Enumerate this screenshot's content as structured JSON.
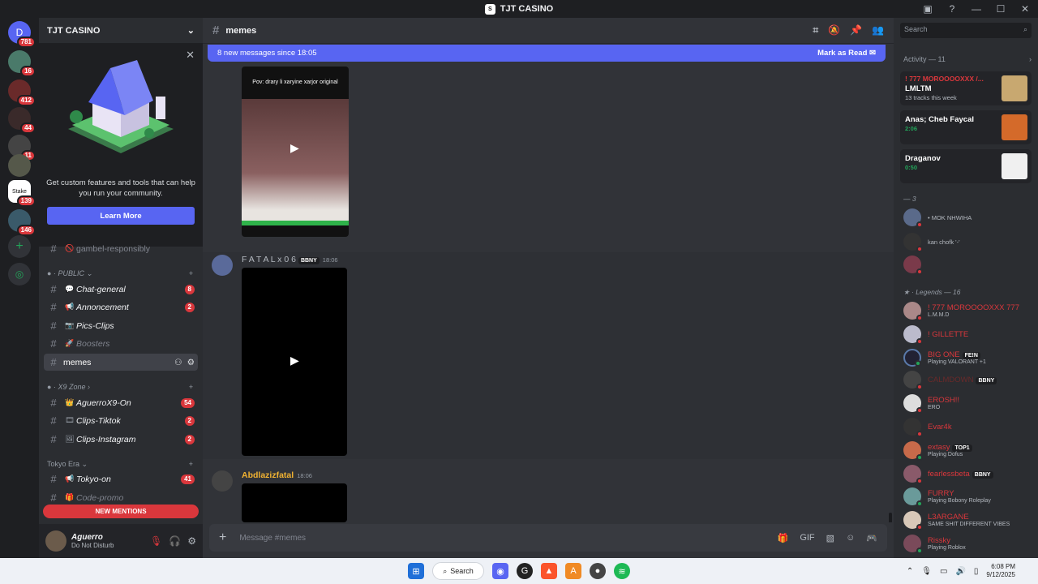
{
  "window": {
    "title": "TJT CASINO"
  },
  "server": {
    "name": "TJT CASINO"
  },
  "guilds": [
    {
      "label": "D",
      "badge": "781"
    },
    {
      "label": "",
      "badge": "16"
    },
    {
      "label": "",
      "badge": "412"
    },
    {
      "label": "",
      "badge": "44"
    },
    {
      "label": "",
      "badge": "11"
    },
    {
      "label": "",
      "badge": ""
    },
    {
      "label": "Stake",
      "badge": "139"
    },
    {
      "label": "",
      "badge": "146"
    }
  ],
  "promo": {
    "text": "Get custom features and tools that can help you run your community.",
    "button": "Learn More"
  },
  "channels": {
    "gambel": "gambel-responsibly",
    "cat_public": "PUBLIC",
    "chat_general": {
      "name": "Chat-general",
      "badge": "8"
    },
    "annoncement": {
      "name": "Annoncement",
      "badge": "2"
    },
    "pics": {
      "name": "Pics-Clips"
    },
    "boosters": {
      "name": "Boosters"
    },
    "memes": {
      "name": "memes"
    },
    "cat_x9": "X9 Zone",
    "aguerro": {
      "name": "AguerroX9-On",
      "badge": "54"
    },
    "tiktok": {
      "name": "Clips-Tiktok",
      "badge": "2"
    },
    "instagram": {
      "name": "Clips-Instagram",
      "badge": "2"
    },
    "cat_tokyo": "Tokyo Era",
    "tokyo": {
      "name": "Tokyo-on",
      "badge": "41"
    },
    "code": {
      "name": "Code-promo"
    }
  },
  "new_mentions": "NEW MENTIONS",
  "user": {
    "name": "Aguerro",
    "status": "Do Not Disturb"
  },
  "channel_header": {
    "name": "memes"
  },
  "banner": {
    "text": "8 new messages since 18:05",
    "action": "Mark as Read"
  },
  "messages": [
    {
      "caption": "Pov: drary li xaryine xarjor original"
    },
    {
      "author": "F A T A L x 0 6",
      "tag": "BBNY",
      "time": "18:06"
    },
    {
      "author": "Abdlazizfatal",
      "time": "18:06"
    }
  ],
  "composer": {
    "placeholder": "Message #memes"
  },
  "search": {
    "placeholder": "Search"
  },
  "activity": {
    "header": "Activity — 11",
    "cards": [
      {
        "user": "! 777 MOROOOOXXX /...",
        "title": "LMLTM",
        "sub": "13 tracks this week"
      },
      {
        "user": "",
        "title": "Anas; Cheb Faycal",
        "sub": "2:06"
      },
      {
        "user": "",
        "title": "Draganov",
        "sub": "0:50"
      }
    ]
  },
  "members": {
    "section1": "— 3",
    "group1": [
      {
        "name": "",
        "status": "• MOK NHWIHA"
      },
      {
        "name": "",
        "status": "kan chofk '-'"
      },
      {
        "name": "",
        "status": ""
      }
    ],
    "section2": "Legends — 16",
    "group2": [
      {
        "name": "! 777 MOROOOOXXX 777",
        "status": "L.M.M.D"
      },
      {
        "name": "! GILLETTE",
        "status": ""
      },
      {
        "name": "BIG ONE",
        "tag": "FE!N",
        "status": "Playing VALORANT +1"
      },
      {
        "name": "CALMDOWN",
        "tag": "BBNY",
        "status": ""
      },
      {
        "name": "EROSH!!",
        "status": "ERO"
      },
      {
        "name": "Evar4k",
        "status": ""
      },
      {
        "name": "extasy",
        "tag": "TOP1",
        "status": "Playing Dofus"
      },
      {
        "name": "fearlessbeta",
        "tag": "BBNY",
        "status": ""
      },
      {
        "name": "FURRY",
        "status": "Playing Bobony Roleplay"
      },
      {
        "name": "L3ARGANE",
        "status": "SAME SHIT DIFFERENT VIBES"
      },
      {
        "name": "Rissky",
        "status": "Playing Roblox"
      }
    ]
  },
  "taskbar": {
    "search": "Search",
    "time": "6:08 PM",
    "date": "9/12/2025"
  }
}
